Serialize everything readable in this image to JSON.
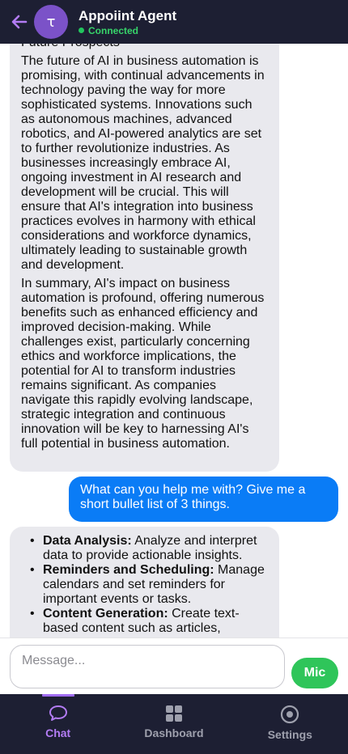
{
  "header": {
    "back_icon": "arrow-left-icon",
    "avatar_letter": "τ",
    "title": "Appoiint Agent",
    "status": "Connected",
    "accent": "#7b52c8",
    "status_color": "#22c55e"
  },
  "messages": {
    "assistant_1": {
      "heading": "Future Prospects",
      "para_1": "The future of AI in business automation is promising, with continual advancements in technology paving the way for more sophisticated systems. Innovations such as autonomous machines, advanced robotics, and AI-powered analytics are set to further revolutionize industries. As businesses increasingly embrace AI, ongoing investment in AI research and development will be crucial. This will ensure that AI's integration into business practices evolves in harmony with ethical considerations and workforce dynamics, ultimately leading to sustainable growth and development.",
      "para_2": "In summary, AI's impact on business automation is profound, offering numerous benefits such as enhanced efficiency and improved decision-making. While challenges exist, particularly concerning ethics and workforce implications, the potential for AI to transform industries remains significant. As companies navigate this rapidly evolving landscape, strategic integration and continuous innovation will be key to harnessing AI's full potential in business automation."
    },
    "user_1": {
      "text": "What can you help me with? Give me a short bullet list of 3 things.",
      "color": "#0a7cf6"
    },
    "assistant_2": {
      "items": [
        {
          "title": "Data Analysis:",
          "text": " Analyze and interpret data to provide actionable insights."
        },
        {
          "title": "Reminders and Scheduling:",
          "text": " Manage calendars and set reminders for important events or tasks."
        },
        {
          "title": "Content Generation:",
          "text": " Create text-based content such as articles,"
        }
      ]
    }
  },
  "composer": {
    "placeholder": "Message...",
    "value": "",
    "mic_label": "Mic",
    "mic_color": "#2fc55a"
  },
  "nav": {
    "active": "Chat",
    "items": [
      {
        "label": "Chat",
        "icon": "chat-bubble-icon"
      },
      {
        "label": "Dashboard",
        "icon": "grid-icon"
      },
      {
        "label": "Settings",
        "icon": "settings-circle-icon"
      }
    ]
  }
}
